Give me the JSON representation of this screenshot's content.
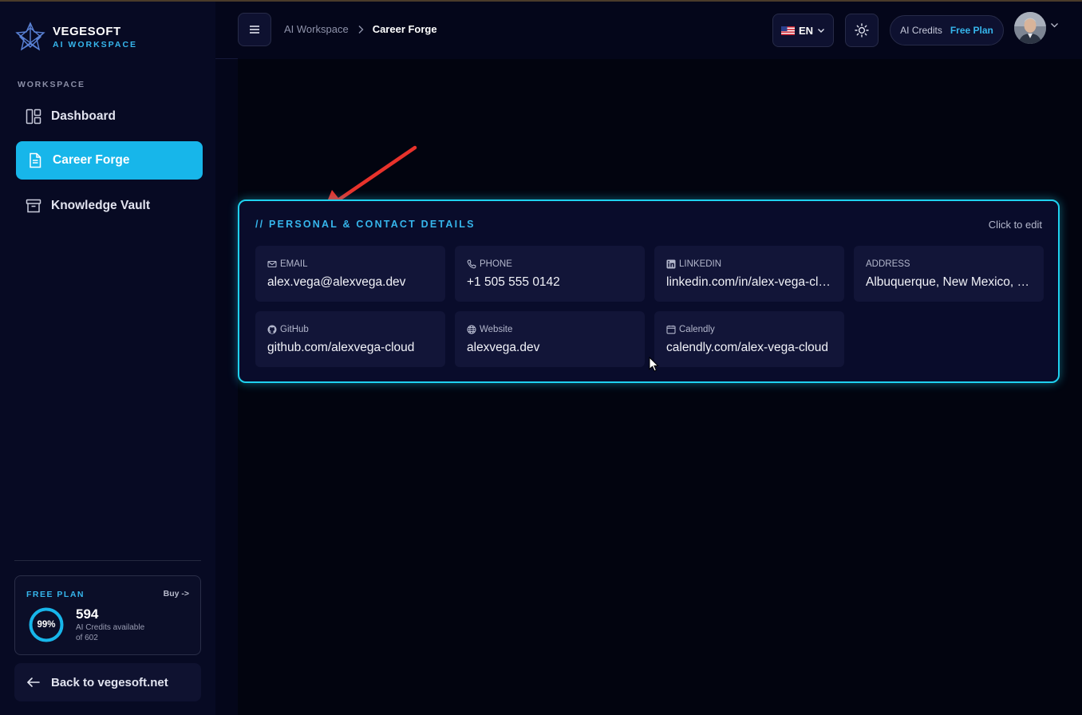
{
  "brand": {
    "name": "VEGESOFT",
    "subtitle": "AI WORKSPACE",
    "logo_icon": "star-logo-icon"
  },
  "sidebar": {
    "section_label": "WORKSPACE",
    "items": [
      {
        "label": "Dashboard",
        "icon": "dashboard-icon",
        "active": false
      },
      {
        "label": "Career Forge",
        "icon": "document-icon",
        "active": true
      },
      {
        "label": "Knowledge Vault",
        "icon": "archive-icon",
        "active": false
      }
    ],
    "plan": {
      "title": "FREE PLAN",
      "buy_label": "Buy ->",
      "percent_label": "99%",
      "percent": 0.99,
      "count": "594",
      "desc_line1": "AI Credits available",
      "desc_line2": "of 602"
    },
    "back_label": "Back to vegesoft.net"
  },
  "header": {
    "breadcrumb": [
      "AI Workspace",
      "Career Forge"
    ],
    "language": "EN",
    "credits_label": "AI Credits",
    "credits_plan": "Free Plan"
  },
  "card": {
    "title": "// PERSONAL & CONTACT DETAILS",
    "edit_hint": "Click to edit",
    "fields": {
      "email": {
        "label": "EMAIL",
        "value": "alex.vega@alexvega.dev",
        "icon": "mail-icon"
      },
      "phone": {
        "label": "PHONE",
        "value": "+1 505 555 0142",
        "icon": "phone-icon"
      },
      "linkedin": {
        "label": "LINKEDIN",
        "value": "linkedin.com/in/alex-vega-cloud",
        "icon": "linkedin-icon"
      },
      "address": {
        "label": "ADDRESS",
        "value": "Albuquerque, New Mexico, USA",
        "icon": ""
      },
      "github": {
        "label": "GitHub",
        "value": "github.com/alexvega-cloud",
        "icon": "github-icon"
      },
      "website": {
        "label": "Website",
        "value": "alexvega.dev",
        "icon": "globe-icon"
      },
      "calendly": {
        "label": "Calendly",
        "value": "calendly.com/alex-vega-cloud",
        "icon": "calendar-icon"
      }
    }
  },
  "colors": {
    "accent": "#17b6ea",
    "accent_text": "#36b6ec",
    "card_border": "#1fd1ef",
    "annotation_arrow": "#e8322b"
  }
}
